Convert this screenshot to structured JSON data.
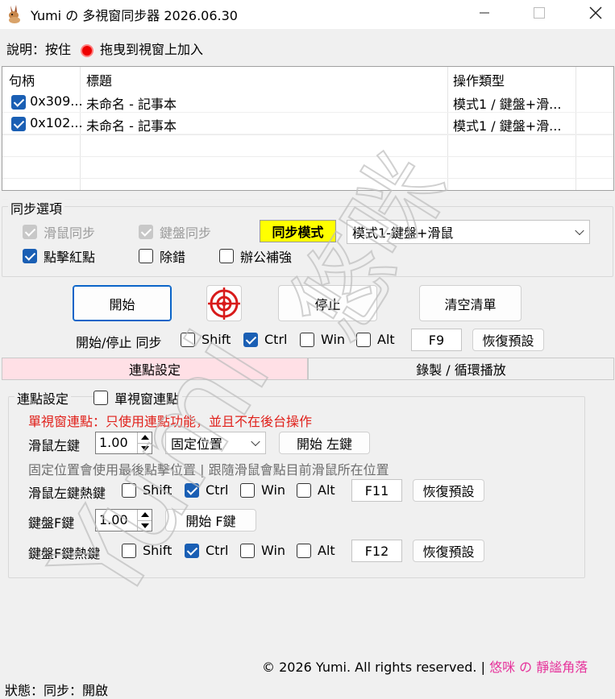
{
  "window": {
    "title": "Yumi の 多視窗同步器 2026.06.30",
    "icons": {
      "app": "rabbit-icon",
      "minimize": "minimize-icon",
      "maximize": "maximize-icon",
      "close": "close-icon"
    }
  },
  "help": {
    "text": "說明：按住",
    "tail": "拖曳到視窗上加入",
    "dot_color": "#e00000"
  },
  "list": {
    "headers": [
      "句柄",
      "標題",
      "操作類型"
    ],
    "rows": [
      {
        "checked": true,
        "handle": "0x309...",
        "title": "未命名 - 記事本",
        "type": "模式1 / 鍵盤+滑..."
      },
      {
        "checked": true,
        "handle": "0x102...",
        "title": "未命名 - 記事本",
        "type": "模式1 / 鍵盤+滑..."
      }
    ]
  },
  "sync_options": {
    "group_label": "同步選項",
    "mouse_sync": "滑鼠同步",
    "keyboard_sync": "鍵盤同步",
    "mode_badge": "同步模式",
    "mode_badge_color": "#ffff00",
    "mode_selected": "模式1-鍵盤+滑鼠",
    "click_red_dot": "點擊紅點",
    "debug": "除錯",
    "office_boost": "辦公補強"
  },
  "actions": {
    "start": "開始",
    "crosshair_icon": "crosshair-icon",
    "stop": "停止",
    "clear_list": "清空清單",
    "hotkey_label": "開始/停止 同步",
    "mods": {
      "shift": "Shift",
      "ctrl": "Ctrl",
      "win": "Win",
      "alt": "Alt"
    },
    "key": "F9",
    "restore_default": "恢復預設"
  },
  "tabs": {
    "click": "連點設定",
    "record": "錄製 / 循環播放",
    "active_color": "#ffe0e6"
  },
  "click_settings": {
    "group_label": "連點設定",
    "single_window": "單視窗連點",
    "warning": "單視窗連點：只使用連點功能，並且不在後台操作",
    "mouse_left_label": "滑鼠左鍵",
    "mouse_left_value": "1.00",
    "position_mode": "固定位置",
    "start_left": "開始 左鍵",
    "hint": "固定位置會使用最後點擊位置 | 跟隨滑鼠會點目前滑鼠所在位置",
    "left_hotkey_label": "滑鼠左鍵熱鍵",
    "left_hotkey_key": "F11",
    "keyf_label": "鍵盤F鍵",
    "keyf_value": "1.00",
    "start_f": "開始 F鍵",
    "f_hotkey_label": "鍵盤F鍵熱鍵",
    "f_hotkey_key": "F12",
    "restore_default": "恢復預設"
  },
  "footer": {
    "copyright": "© 2026 Yumi. All rights reserved. |",
    "brand": "悠咪 の 靜謐角落",
    "status": "狀態：同步：開啟"
  },
  "watermark_text": "Yumi 悠咪"
}
